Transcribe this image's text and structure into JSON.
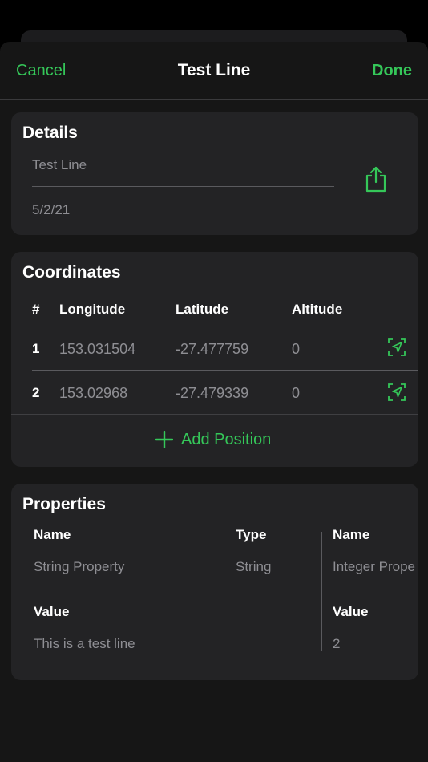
{
  "nav": {
    "cancel_label": "Cancel",
    "title": "Test Line",
    "done_label": "Done"
  },
  "details": {
    "heading": "Details",
    "name_value": "Test Line",
    "date_value": "5/2/21",
    "share_icon": "share-icon"
  },
  "coordinates": {
    "heading": "Coordinates",
    "columns": [
      "#",
      "Longitude",
      "Latitude",
      "Altitude"
    ],
    "rows": [
      {
        "index": "1",
        "longitude": "153.031504",
        "latitude": "-27.477759",
        "altitude": "0"
      },
      {
        "index": "2",
        "longitude": "153.02968",
        "latitude": "-27.479339",
        "altitude": "0"
      }
    ],
    "add_label": "Add Position"
  },
  "properties": {
    "heading": "Properties",
    "name_label": "Name",
    "type_label": "Type",
    "value_label": "Value",
    "items": [
      {
        "name": "String Property",
        "type": "String",
        "value": "This is a test line"
      },
      {
        "name": "Integer Prope",
        "value": "2"
      }
    ]
  },
  "colors": {
    "accent": "#35c759",
    "background": "#000000",
    "card": "#232325"
  }
}
